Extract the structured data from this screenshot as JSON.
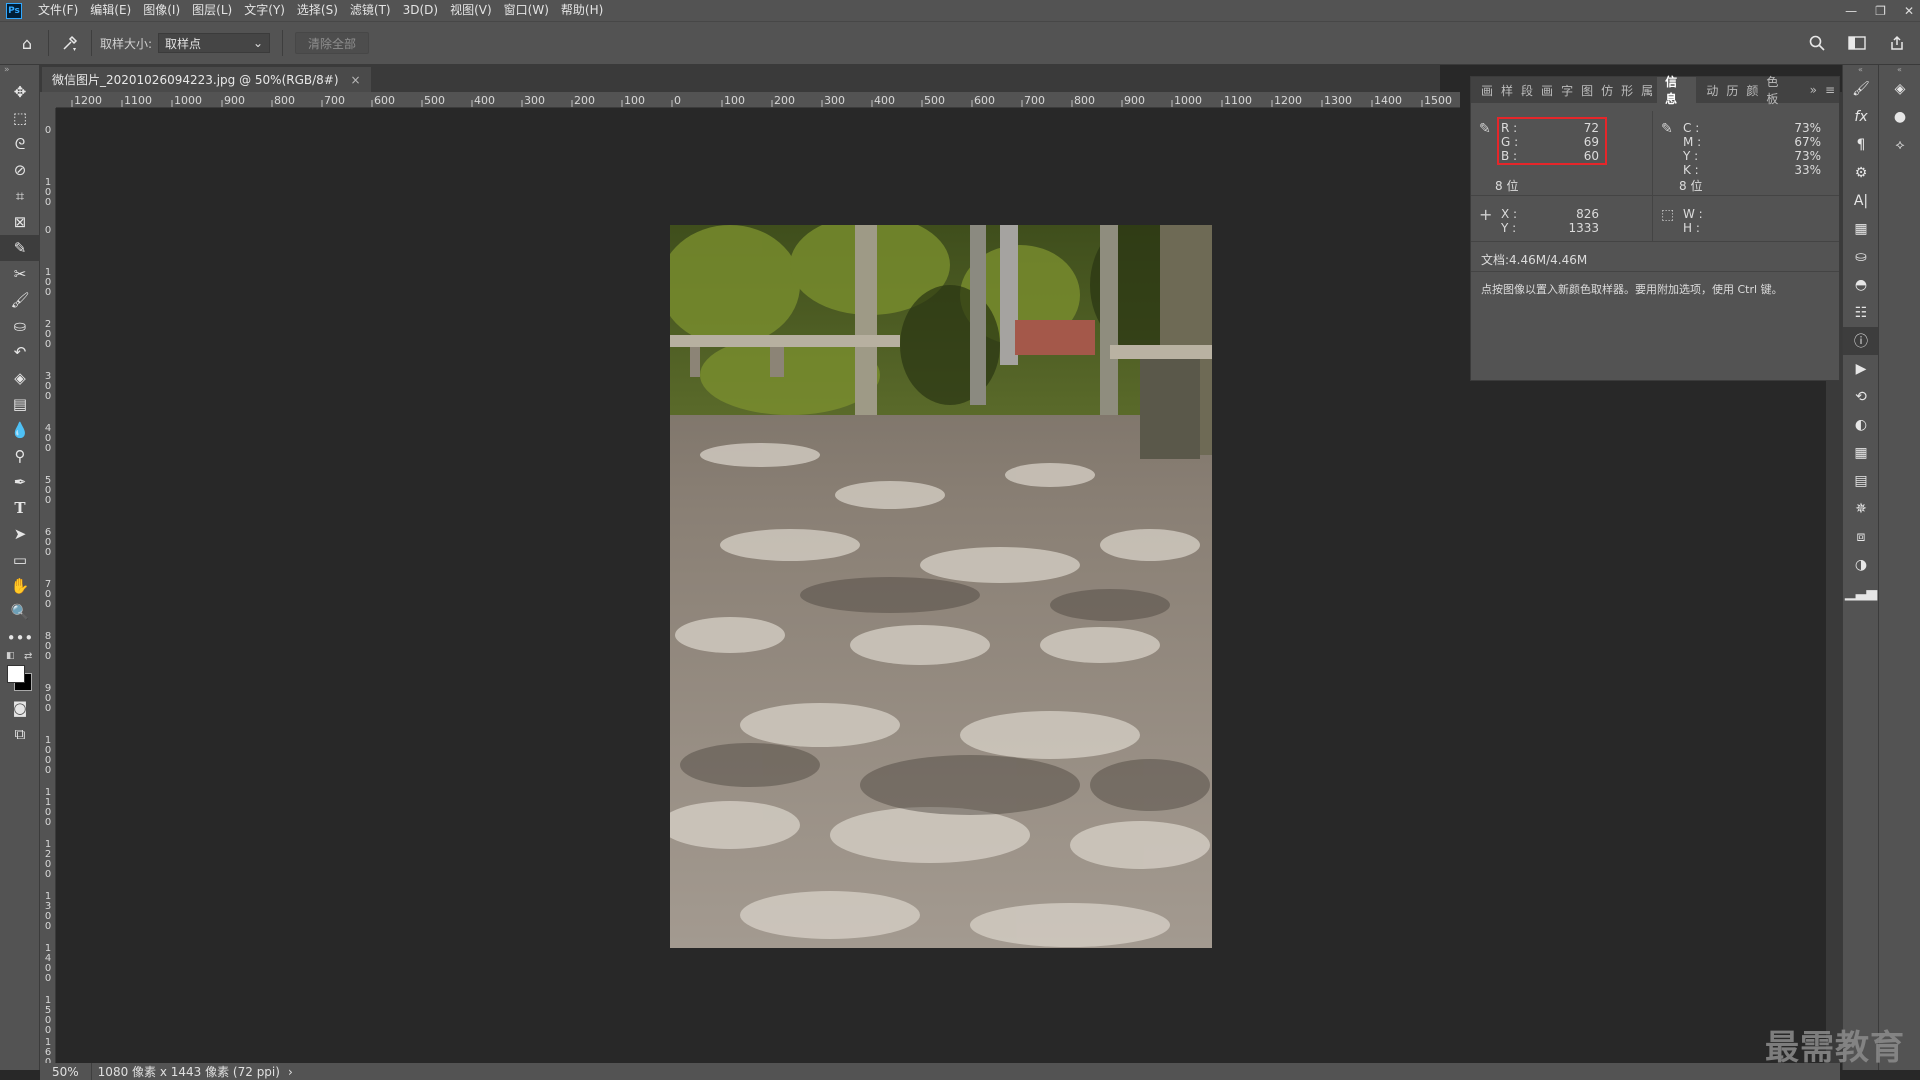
{
  "menubar": {
    "logo": "Ps",
    "items": [
      "文件(F)",
      "编辑(E)",
      "图像(I)",
      "图层(L)",
      "文字(Y)",
      "选择(S)",
      "滤镜(T)",
      "3D(D)",
      "视图(V)",
      "窗口(W)",
      "帮助(H)"
    ],
    "window_controls": [
      "—",
      "❐",
      "✕"
    ]
  },
  "options": {
    "sample_size_label": "取样大小:",
    "sample_size_value": "取样点",
    "clear_all_label": "清除全部"
  },
  "document": {
    "tab_title": "微信图片_20201026094223.jpg @ 50%(RGB/8#)",
    "close_glyph": "×"
  },
  "ruler": {
    "top_labels": [
      "1200",
      "1100",
      "1000",
      "900",
      "800",
      "700",
      "600",
      "500",
      "400",
      "300",
      "200",
      "100",
      "0",
      "100",
      "200",
      "300",
      "400",
      "500",
      "600",
      "700",
      "800",
      "900",
      "1000",
      "1100",
      "1200",
      "1300",
      "1400",
      "1500"
    ],
    "left_labels": [
      "0",
      "100",
      "0",
      "100",
      "200",
      "300",
      "400",
      "500",
      "600",
      "700",
      "800",
      "900",
      "1000",
      "1100",
      "1200",
      "1300",
      "1400",
      "1500",
      "1600"
    ]
  },
  "status": {
    "zoom": "50%",
    "doc_info": "1080 像素 x 1443 像素 (72 ppi)",
    "arrow": "›"
  },
  "info_panel": {
    "tabs": [
      "画",
      "样",
      "段",
      "画",
      "字",
      "图",
      "仿",
      "形",
      "属",
      "信息",
      "动",
      "历",
      "颜",
      "色板"
    ],
    "active_tab": "信息",
    "rgb": {
      "r_label": "R :",
      "g_label": "G :",
      "b_label": "B :",
      "r": "72",
      "g": "69",
      "b": "60"
    },
    "cmyk": {
      "c_label": "C :",
      "m_label": "M :",
      "y_label": "Y :",
      "k_label": "K :",
      "c": "73%",
      "m": "67%",
      "y": "73%",
      "k": "33%"
    },
    "bits_left": "8 位",
    "bits_right": "8 位",
    "xy": {
      "x_label": "X :",
      "y_label": "Y :",
      "x": "826",
      "y": "1333"
    },
    "wh": {
      "w_label": "W :",
      "h_label": "H :"
    },
    "doc_size": "文档:4.46M/4.46M",
    "hint": "点按图像以置入新颜色取样器。要用附加选项，使用 Ctrl 键。"
  },
  "watermark": "最需教育",
  "colors": {
    "highlight": "#e6262a",
    "chrome": "#535353",
    "canvas": "#282828"
  }
}
